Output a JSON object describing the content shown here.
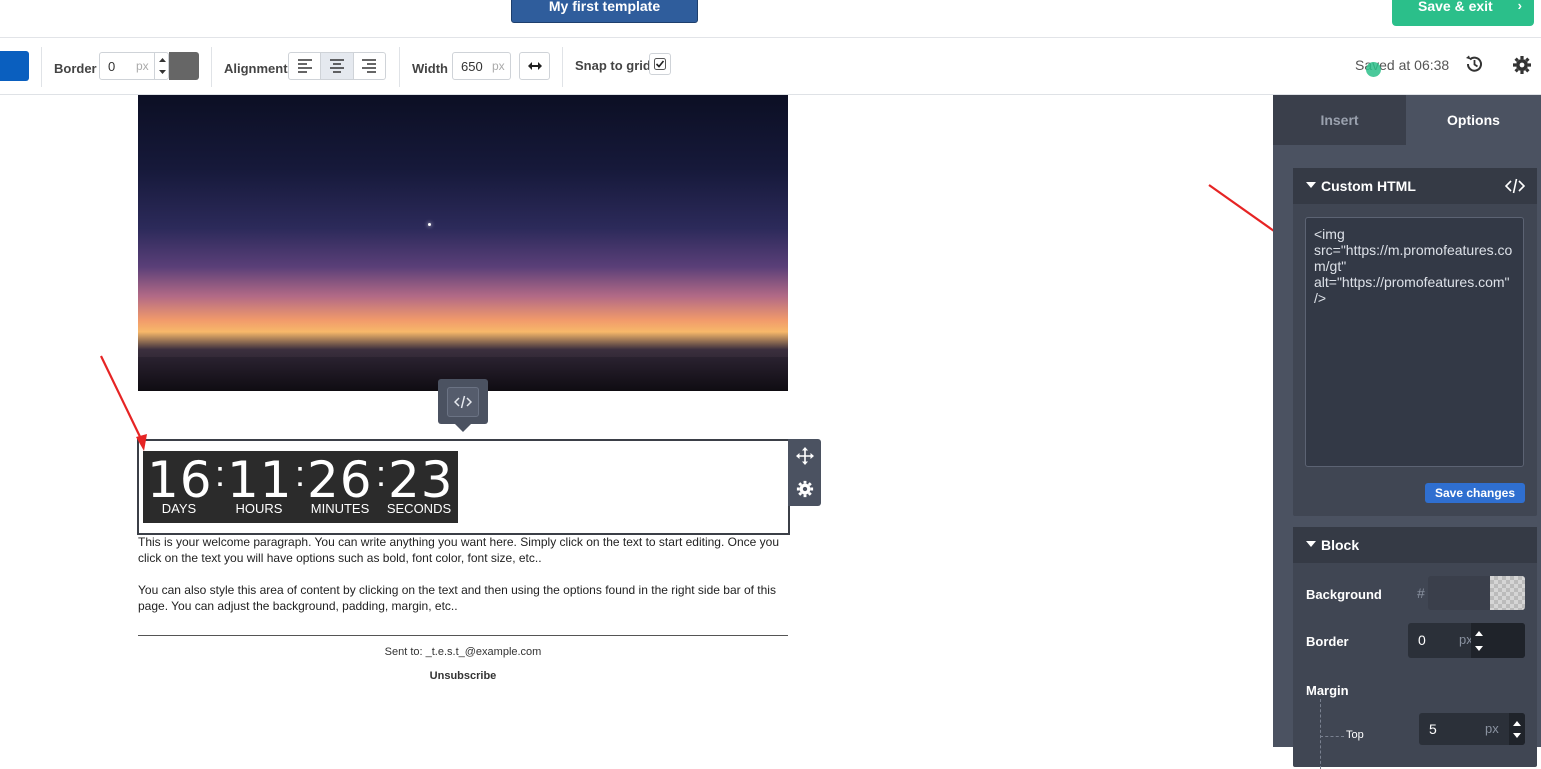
{
  "header": {
    "template_name": "My first template",
    "save_exit_label": "Save & exit",
    "save_exit_chevron": "›"
  },
  "toolbar": {
    "border_label": "Border",
    "border_value": "0",
    "border_unit": "px",
    "alignment_label": "Alignment",
    "alignment_options": [
      "left",
      "center",
      "right"
    ],
    "alignment_selected": "center",
    "width_label": "Width",
    "width_value": "650",
    "width_unit": "px",
    "snap_label": "Snap to grid",
    "snap_checked": true,
    "saved_text": "Saved at 06:38",
    "colors": {
      "swatch": "#0a5fbf",
      "border_swatch": "#666666"
    }
  },
  "canvas": {
    "timer": {
      "days": "16",
      "hours": "11",
      "minutes": "26",
      "seconds": "23",
      "separator": ":",
      "labels": {
        "days": "DAYS",
        "hours": "HOURS",
        "minutes": "MINUTES",
        "seconds": "SECONDS"
      }
    },
    "paragraph1": "This is your welcome paragraph. You can write anything you want here. Simply click on the text to start editing. Once you click on the text you will have options such as bold, font color, font size, etc..",
    "paragraph2": "You can also style this area of content by clicking on the text and then using the options found in the right side bar of this page. You can adjust the background, padding, margin, etc..",
    "sent_to": "Sent to: _t.e.s.t_@example.com",
    "unsubscribe": "Unsubscribe"
  },
  "panel": {
    "tabs": {
      "insert": "Insert",
      "options": "Options",
      "active": "Options"
    },
    "custom_html": {
      "title": "Custom HTML",
      "code": "<img\nsrc=\"https://m.promofeatures.com/gt\"\nalt=\"https://promofeatures.com\" />",
      "save_label": "Save changes"
    },
    "block": {
      "title": "Block",
      "background_label": "Background",
      "background_hash": "#",
      "border_label": "Border",
      "border_value": "0",
      "border_unit": "px",
      "margin_label": "Margin",
      "top_label": "Top",
      "top_value": "5",
      "top_unit": "px"
    }
  },
  "icons": [
    "code-icon",
    "move-icon",
    "gear-icon",
    "history-icon",
    "checkbox-checked-icon",
    "width-arrows-icon",
    "align-left-icon",
    "align-center-icon",
    "align-right-icon",
    "caret-down-icon"
  ]
}
